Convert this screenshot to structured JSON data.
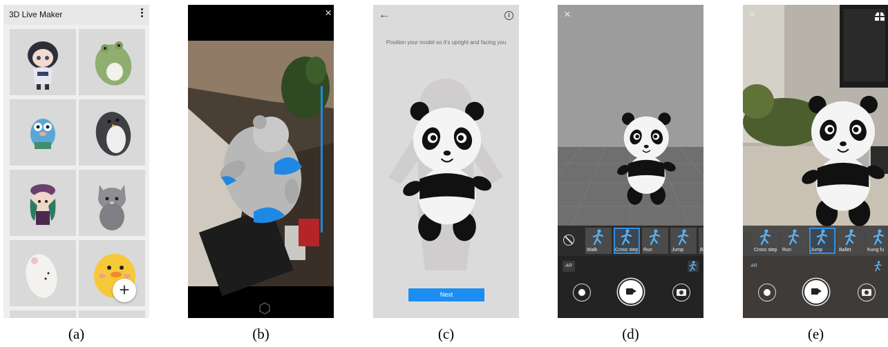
{
  "captions": [
    "(a)",
    "(b)",
    "(c)",
    "(d)",
    "(e)"
  ],
  "gallery": {
    "title": "3D Live Maker",
    "menu_icon": "more-vert-icon",
    "fab_symbol": "+",
    "models": [
      "anime-girl-figure",
      "green-frog-plush",
      "blue-gopher-figure",
      "penguin-plush",
      "purple-hat-figure",
      "gray-cat-plush",
      "white-hamster-plush",
      "yellow-chick-plush"
    ]
  },
  "scan": {
    "close_symbol": "×",
    "progress": 0.75,
    "accent": "#1e88e5"
  },
  "position": {
    "back_symbol": "←",
    "info_symbol": "i",
    "instruction": "Position your model so it's upright and facing you",
    "next_label": "Next",
    "accent": "#1c8ef2"
  },
  "animate_d": {
    "close_symbol": "×",
    "ar_label": "AR",
    "animations": [
      {
        "label": "Walk",
        "selected": false
      },
      {
        "label": "Cross step",
        "selected": true
      },
      {
        "label": "Run",
        "selected": false
      },
      {
        "label": "Jump",
        "selected": false
      },
      {
        "label": "B",
        "selected": false
      }
    ]
  },
  "animate_e": {
    "close_symbol": "×",
    "ar_label": "AR",
    "animations": [
      {
        "label": "Cross step",
        "selected": false
      },
      {
        "label": "Run",
        "selected": false
      },
      {
        "label": "Jump",
        "selected": true
      },
      {
        "label": "Ballet",
        "selected": false
      },
      {
        "label": "Kung fu",
        "selected": false
      }
    ]
  },
  "colors": {
    "selection": "#2f8fe4",
    "panda_black": "#111111",
    "panda_white": "#f4f4f4"
  }
}
